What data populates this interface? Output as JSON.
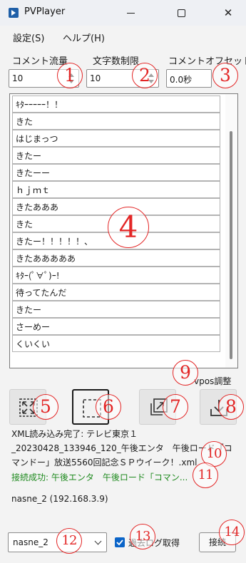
{
  "window": {
    "title": "PVPlayer"
  },
  "menu": [
    "設定(S)",
    "ヘルプ(H)"
  ],
  "fields": {
    "comment_flow": {
      "label": "コメント流量",
      "value": "10"
    },
    "char_limit": {
      "label": "文字数制限",
      "value": "10"
    },
    "comment_offset": {
      "label": "コメントオフセット",
      "value": "0.0秒"
    }
  },
  "comments": [
    "ｷﾀｰｰｰｰｰ！！",
    "きた",
    "はじまっつ",
    "きたー",
    "きたーー",
    "ｈｊｍｔ",
    "きたあああ",
    "きた",
    "きたー！！！！！、",
    "きたあああああ",
    "ｷﾀｰ(ﾟ∀ﾟ)ｰ!",
    "待ってたんだ",
    "きたー",
    "さーめー",
    "くいくい"
  ],
  "vpos_label": "vpos調整",
  "toolbar": {
    "icons": [
      "fullscreen-icon",
      "frame-icon",
      "export-icon",
      "download-icon"
    ]
  },
  "message": "XML読み込み完了: テレビ東京１_20230428_133946_120_午後エンタ　午後ロード「コマンドー」放送5560回記念ＳＰウイーク！.xml",
  "status": "接続成功: 午後エンタ　午後ロード「コマン...",
  "device_info": "nasne_2 (192.168.3.9)",
  "device_select": {
    "value": "nasne_2"
  },
  "past_log": {
    "label": "過去ログ取得",
    "checked": true
  },
  "connect_label": "接続",
  "callouts": [
    "1",
    "2",
    "3",
    "4",
    "5",
    "6",
    "7",
    "8",
    "9",
    "10",
    "11",
    "12",
    "13",
    "14"
  ],
  "colors": {
    "callout": "#e32626",
    "status": "#1f8a1f",
    "accent": "#0a64c8"
  }
}
